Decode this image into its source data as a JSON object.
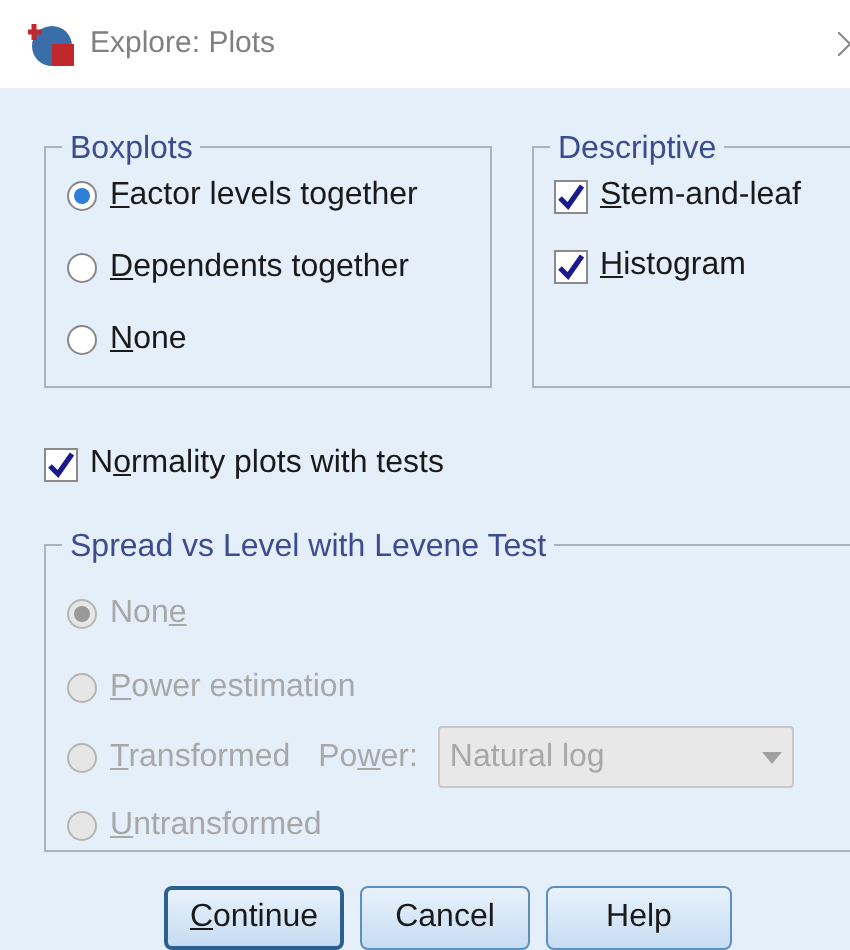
{
  "window": {
    "title": "Explore: Plots"
  },
  "boxplots": {
    "title": "Boxplots",
    "options": [
      {
        "key": "F",
        "after": "actor levels together",
        "selected": true
      },
      {
        "key": "D",
        "after": "ependents together",
        "selected": false
      },
      {
        "key": "N",
        "after": "one",
        "selected": false
      }
    ]
  },
  "descriptive": {
    "title": "Descriptive",
    "options": [
      {
        "key": "S",
        "after": "tem-and-leaf",
        "checked": true
      },
      {
        "key": "H",
        "after": "istogram",
        "checked": true
      }
    ]
  },
  "normality": {
    "before": "N",
    "key": "o",
    "after": "rmality plots with tests",
    "checked": true
  },
  "spread": {
    "title": "Spread vs Level with Levene Test",
    "disabled": true,
    "options": [
      {
        "before": "Non",
        "key": "e",
        "selected": true
      },
      {
        "key": "P",
        "after": "ower estimation",
        "selected": false
      },
      {
        "key": "T",
        "after": "ransformed",
        "selected": false,
        "power": {
          "before": "Po",
          "key": "w",
          "after": "er:",
          "value": "Natural log"
        }
      },
      {
        "key": "U",
        "after": "ntransformed",
        "selected": false
      }
    ]
  },
  "buttons": [
    {
      "key": "C",
      "after": "ontinue",
      "focused": true
    },
    {
      "before": "Cancel",
      "focused": false
    },
    {
      "before": "Help",
      "focused": false
    }
  ]
}
